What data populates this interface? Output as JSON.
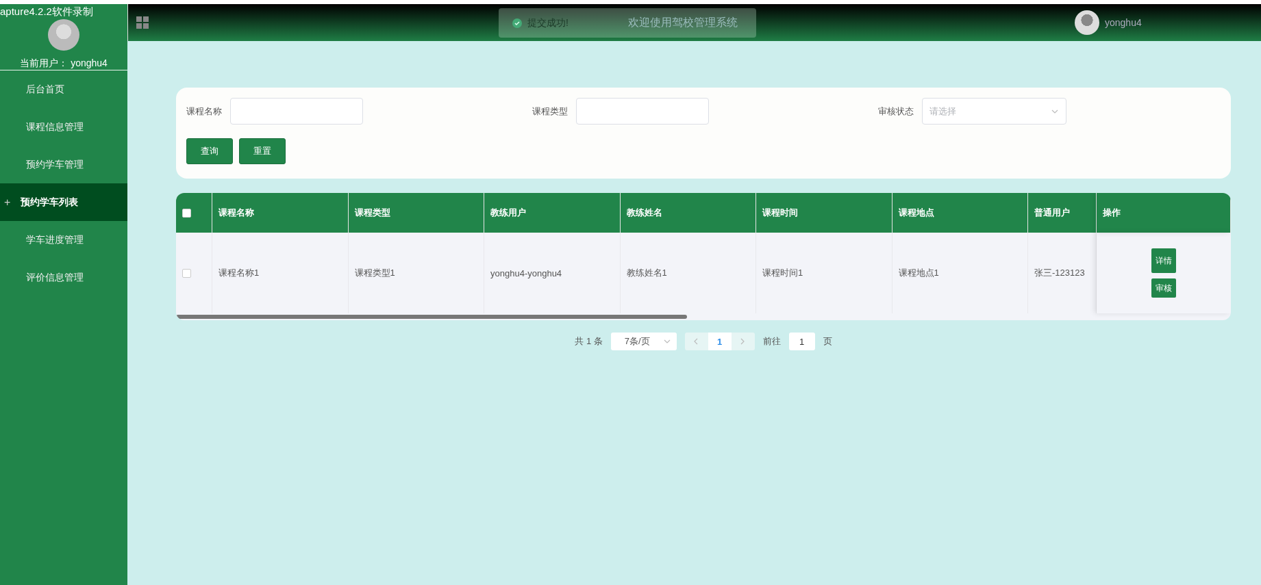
{
  "app_caption": "apture4.2.2软件录制",
  "current_user": {
    "label": "当前用户：",
    "name": "yonghu4"
  },
  "sidebar": {
    "items": [
      {
        "label": "后台首页",
        "selected": false
      },
      {
        "label": "课程信息管理",
        "selected": false
      },
      {
        "label": "预约学车管理",
        "selected": false
      },
      {
        "label": "预约学车列表",
        "selected": true,
        "prefix": "+"
      },
      {
        "label": "学车进度管理",
        "selected": false
      },
      {
        "label": "评价信息管理",
        "selected": false
      }
    ]
  },
  "header": {
    "title": "欢迎使用驾校管理系统",
    "user": "yonghu4"
  },
  "toast": {
    "message": "提交成功!"
  },
  "search": {
    "fields": [
      {
        "label": "课程名称",
        "kind": "input"
      },
      {
        "label": "课程类型",
        "kind": "input"
      },
      {
        "label": "审核状态",
        "kind": "select",
        "placeholder": "请选择"
      }
    ],
    "buttons": [
      "查询",
      "重置"
    ]
  },
  "table": {
    "select_all": {
      "checked": false
    },
    "columns": [
      "课程名称",
      "课程类型",
      "教练用户",
      "教练姓名",
      "课程时间",
      "课程地点",
      "普通用户"
    ],
    "action_column": "操作",
    "rows": [
      {
        "checked": false,
        "cells": [
          "课程名称1",
          "课程类型1",
          "yonghu4-yonghu4",
          "教练姓名1",
          "课程时间1",
          "课程地点1",
          "张三-123123"
        ],
        "actions": [
          "详情",
          "审核"
        ]
      }
    ]
  },
  "pagination": {
    "total": "共 1 条",
    "page_size": "7条/页",
    "pages": [
      {
        "label": "1",
        "selected": true
      }
    ],
    "goto_label": "前往",
    "goto_value": "1",
    "goto_suffix": "页"
  }
}
